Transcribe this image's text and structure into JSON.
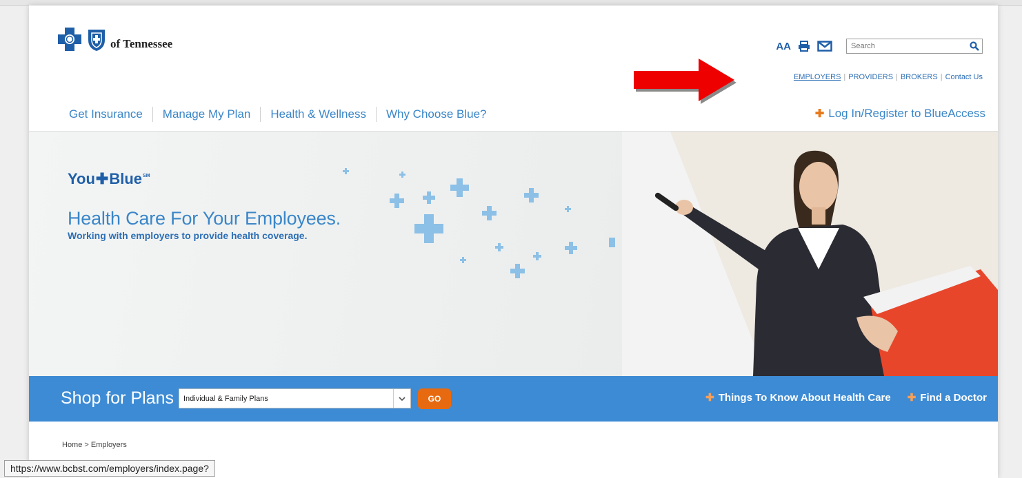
{
  "logo": {
    "text": "of Tennessee"
  },
  "utility": {
    "font_size_label": "AA",
    "search_placeholder": "Search"
  },
  "audience_links": [
    {
      "label": "EMPLOYERS"
    },
    {
      "label": "PROVIDERS"
    },
    {
      "label": "BROKERS"
    },
    {
      "label": "Contact Us"
    }
  ],
  "main_nav": [
    {
      "label": "Get Insurance"
    },
    {
      "label": "Manage My Plan"
    },
    {
      "label": "Health & Wellness"
    },
    {
      "label": "Why Choose Blue?"
    }
  ],
  "login": {
    "label": "Log In/Register to BlueAccess"
  },
  "hero": {
    "brand_you": "You",
    "brand_blue": "Blue",
    "brand_sm": "SM",
    "title": "Health Care For Your Employees.",
    "subtitle": "Working with employers to provide health coverage."
  },
  "shop": {
    "label": "Shop for Plans",
    "selected_plan": "Individual & Family Plans",
    "go_label": "GO",
    "links": [
      {
        "label": "Things To Know About Health Care"
      },
      {
        "label": "Find a Doctor"
      }
    ]
  },
  "breadcrumb": "Home > Employers",
  "status_url": "https://www.bcbst.com/employers/index.page?",
  "colors": {
    "brand_blue": "#1f5fa8",
    "nav_blue": "#3a86c8",
    "shop_bar": "#3d8bd4",
    "go_orange": "#e86a10",
    "arrow_red": "#ee0000"
  }
}
